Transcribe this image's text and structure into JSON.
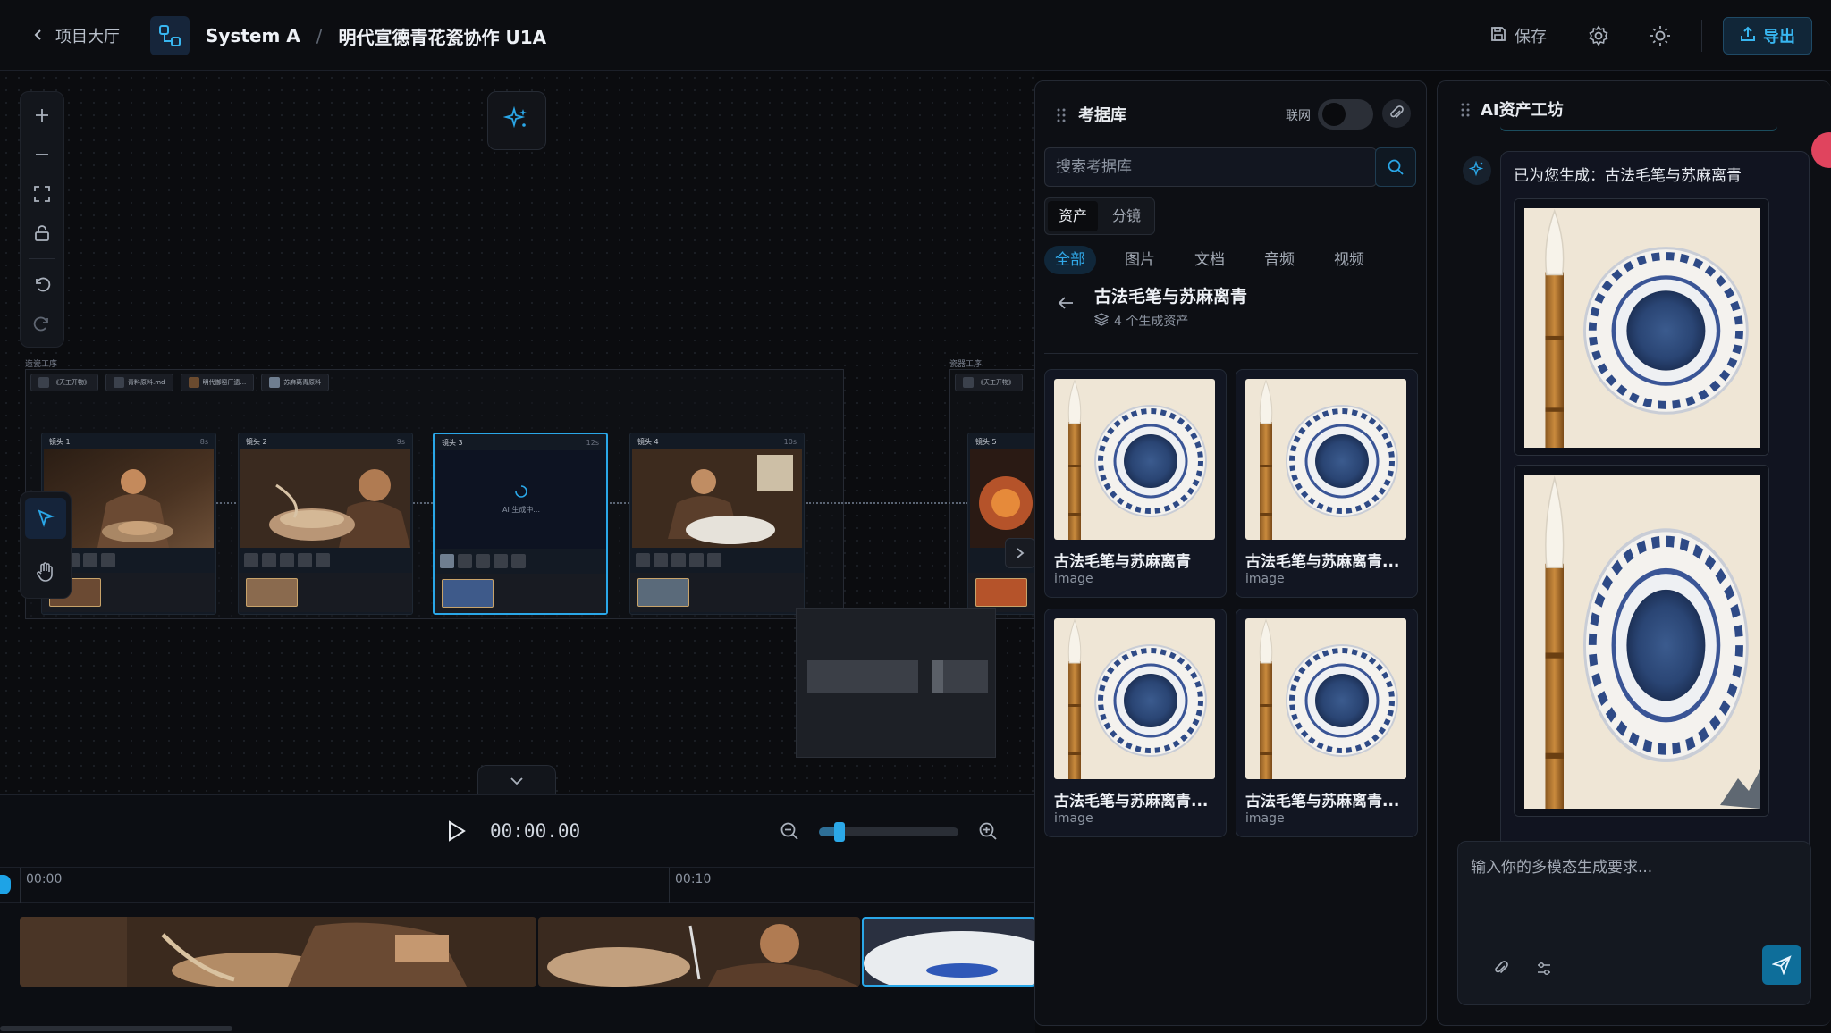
{
  "header": {
    "back_label": "项目大厅",
    "crumb_project": "System A",
    "crumb_sep": "/",
    "crumb_title": "明代宣德青花瓷协作 U1A",
    "save_label": "保存",
    "export_label": "导出"
  },
  "canvas": {
    "group_label_1": "造瓷工序",
    "group_label_2": "瓷器工序",
    "asset_chips": [
      "《天工开物》",
      "青料原料.md",
      "明代御窑厂遗...",
      "苏麻离青原料"
    ],
    "asset_chip_right": "《天工开物》",
    "shots": [
      {
        "label": "镜头 1",
        "duration": "8s"
      },
      {
        "label": "镜头 2",
        "duration": "9s"
      },
      {
        "label": "镜头 3",
        "duration": "12s"
      },
      {
        "label": "镜头 4",
        "duration": "10s"
      },
      {
        "label": "镜头 5",
        "duration": ""
      }
    ],
    "ai_generating": "AI 生成中..."
  },
  "timeline": {
    "current_time": "00:00.00",
    "ticks": [
      "00:00",
      "00:10"
    ],
    "zoom_level": 0.15
  },
  "reference_library": {
    "title": "考据库",
    "network_label": "联网",
    "network_enabled": false,
    "search_placeholder": "搜索考据库",
    "segments": [
      "资产",
      "分镜"
    ],
    "filters": [
      "全部",
      "图片",
      "文档",
      "音频",
      "视频"
    ],
    "collection_title": "古法毛笔与苏麻离青",
    "collection_count": "4 个生成资产",
    "cards": [
      {
        "name": "古法毛笔与苏麻离青",
        "type": "image"
      },
      {
        "name": "古法毛笔与苏麻离青...",
        "type": "image"
      },
      {
        "name": "古法毛笔与苏麻离青...",
        "type": "image"
      },
      {
        "name": "古法毛笔与苏麻离青...",
        "type": "image"
      }
    ]
  },
  "ai_workshop": {
    "title": "AI资产工坊",
    "message": "已为您生成：古法毛笔与苏麻离青",
    "input_placeholder": "输入你的多模态生成要求..."
  },
  "colors": {
    "accent": "#2aa7e8",
    "background": "#0a0b0e",
    "panel": "#0d0f14"
  },
  "icons": [
    "chevron-left-icon",
    "nodes-logo-icon",
    "save-icon",
    "gear-icon",
    "sun-icon",
    "export-icon",
    "plus-icon",
    "minus-icon",
    "fit-screen-icon",
    "lock-icon",
    "undo-icon",
    "redo-icon",
    "sparkle-icon",
    "cursor-icon",
    "hand-icon",
    "chevron-right-icon",
    "chevron-down-icon",
    "play-icon",
    "zoom-out-icon",
    "zoom-in-icon",
    "grip-icon",
    "paperclip-icon",
    "search-icon",
    "arrow-left-icon",
    "layers-icon",
    "sliders-icon",
    "send-icon"
  ]
}
